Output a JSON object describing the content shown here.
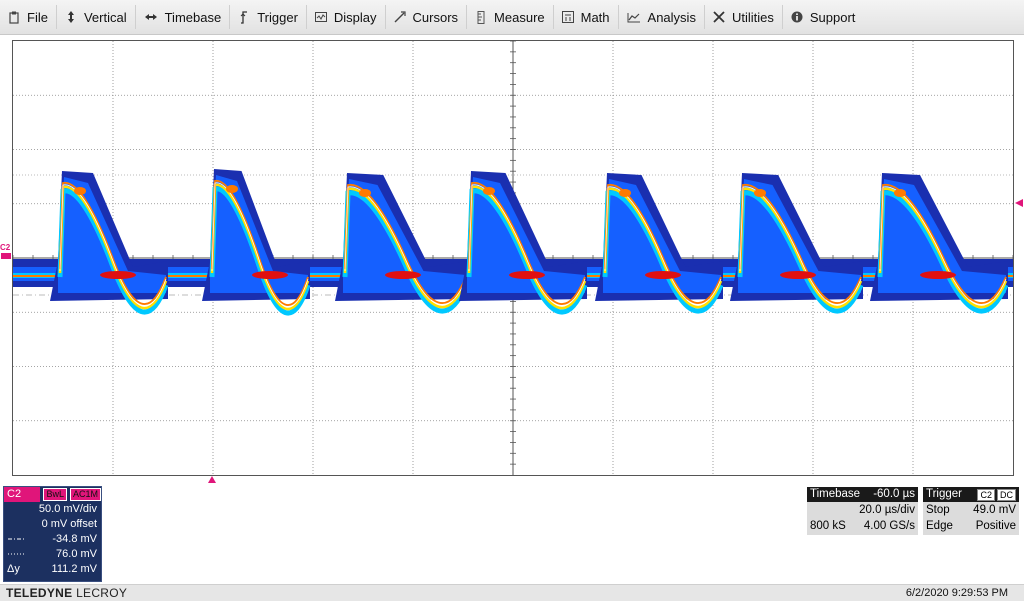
{
  "menu": [
    {
      "label": "File",
      "icon": "clipboard-icon"
    },
    {
      "label": "Vertical",
      "icon": "vertical-arrow-icon"
    },
    {
      "label": "Timebase",
      "icon": "horizontal-arrow-icon"
    },
    {
      "label": "Trigger",
      "icon": "trigger-edge-icon"
    },
    {
      "label": "Display",
      "icon": "display-icon"
    },
    {
      "label": "Cursors",
      "icon": "cursor-icon"
    },
    {
      "label": "Measure",
      "icon": "measure-icon"
    },
    {
      "label": "Math",
      "icon": "calculator-icon"
    },
    {
      "label": "Analysis",
      "icon": "analysis-icon"
    },
    {
      "label": "Utilities",
      "icon": "tools-icon"
    },
    {
      "label": "Support",
      "icon": "info-icon"
    }
  ],
  "channel": {
    "name": "C2",
    "badges": [
      "BwL",
      "AC1M"
    ],
    "volts_div": "50.0 mV/div",
    "offset": "0 mV offset",
    "cursor1": "-34.8 mV",
    "cursor2": "76.0 mV",
    "delta_label": "Δy",
    "delta": "111.2 mV"
  },
  "ground_tag": "C2",
  "timebase": {
    "title": "Timebase",
    "delay": "-60.0 µs",
    "time_div": "20.0 µs/div",
    "samples": "800 kS",
    "rate": "4.00 GS/s"
  },
  "trigger": {
    "title": "Trigger",
    "source": "C2",
    "coupling": "DC",
    "mode": "Stop",
    "level": "49.0 mV",
    "type": "Edge",
    "slope": "Positive"
  },
  "footer": {
    "brand_bold": "TELEDYNE",
    "brand_light": "LECROY",
    "timestamp": "6/2/2020 9:29:53 PM"
  },
  "colors": {
    "channel": "#e0157a",
    "persistence": [
      "#1a2fb0",
      "#1560ff",
      "#00c8ff",
      "#ffe000",
      "#ff7a00",
      "#e01010"
    ]
  }
}
